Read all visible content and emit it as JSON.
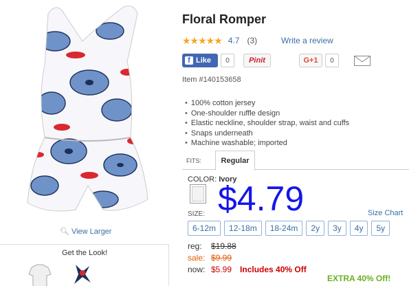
{
  "product": {
    "title": "Floral Romper",
    "stars": "★★★★★",
    "rating": "4.7",
    "review_count": "(3)",
    "write_review": "Write a review",
    "item_number": "Item #140153658",
    "features": [
      "100% cotton jersey",
      "One-shoulder ruffle design",
      "Elastic neckline, shoulder strap, waist and cuffs",
      "Snaps underneath",
      "Machine washable; imported"
    ]
  },
  "social": {
    "facebook_label": "Like",
    "facebook_letter": "f",
    "facebook_count": "0",
    "pinterest_label": "Pinit",
    "gplus_label": "G+1",
    "gplus_count": "0"
  },
  "image_panel": {
    "view_larger": "View Larger",
    "get_the_look": "Get the Look!"
  },
  "fits": {
    "label": "FITS:",
    "selected_tab": "Regular"
  },
  "color": {
    "label": "COLOR:",
    "value": "Ivory"
  },
  "overlay_price": "$4.79",
  "size": {
    "label": "SIZE:",
    "size_chart": "Size Chart",
    "options": [
      "6-12m",
      "12-18m",
      "18-24m",
      "2y",
      "3y",
      "4y",
      "5y"
    ]
  },
  "pricing": {
    "reg_label": "reg:",
    "reg_value": "$19.88",
    "sale_label": "sale:",
    "sale_value": "$9.99",
    "now_label": "now:",
    "now_value": "$5.99",
    "promo": "Includes 40% Off",
    "extra": "EXTRA 40% Off!"
  },
  "colors": {
    "link": "#3a6ea5",
    "star": "#f5a623",
    "overlay_price": "#1515e8",
    "sale": "#e05a00",
    "now": "#cc0000",
    "extra": "#6ab023"
  }
}
